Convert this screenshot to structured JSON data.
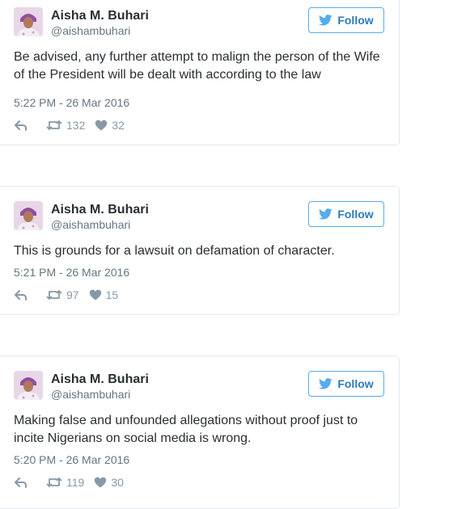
{
  "tweets": [
    {
      "author_name": "Aisha M. Buhari",
      "author_handle": "@aishambuhari",
      "follow_label": "Follow",
      "text": "Be advised, any further attempt to malign the person of the Wife of the President will be dealt with according to the law",
      "timestamp": "5:22 PM - 26 Mar 2016",
      "retweets": "132",
      "likes": "32"
    },
    {
      "author_name": "Aisha M. Buhari",
      "author_handle": "@aishambuhari",
      "follow_label": "Follow",
      "text": "This is grounds for a lawsuit on defamation of character.",
      "timestamp": "5:21 PM - 26 Mar 2016",
      "retweets": "97",
      "likes": "15"
    },
    {
      "author_name": "Aisha M. Buhari",
      "author_handle": "@aishambuhari",
      "follow_label": "Follow",
      "text": "Making false and unfounded allegations without proof just to incite Nigerians on social media is wrong.",
      "timestamp": "5:20 PM - 26 Mar 2016",
      "retweets": "119",
      "likes": "30"
    }
  ],
  "colors": {
    "follow_border": "#55acee",
    "follow_text": "#2b7bb9",
    "meta_text": "#66757f",
    "action_icon": "#8899a6",
    "card_border": "#e1e8ed"
  },
  "icons": [
    "twitter-bird-icon",
    "reply-icon",
    "retweet-icon",
    "heart-icon"
  ]
}
